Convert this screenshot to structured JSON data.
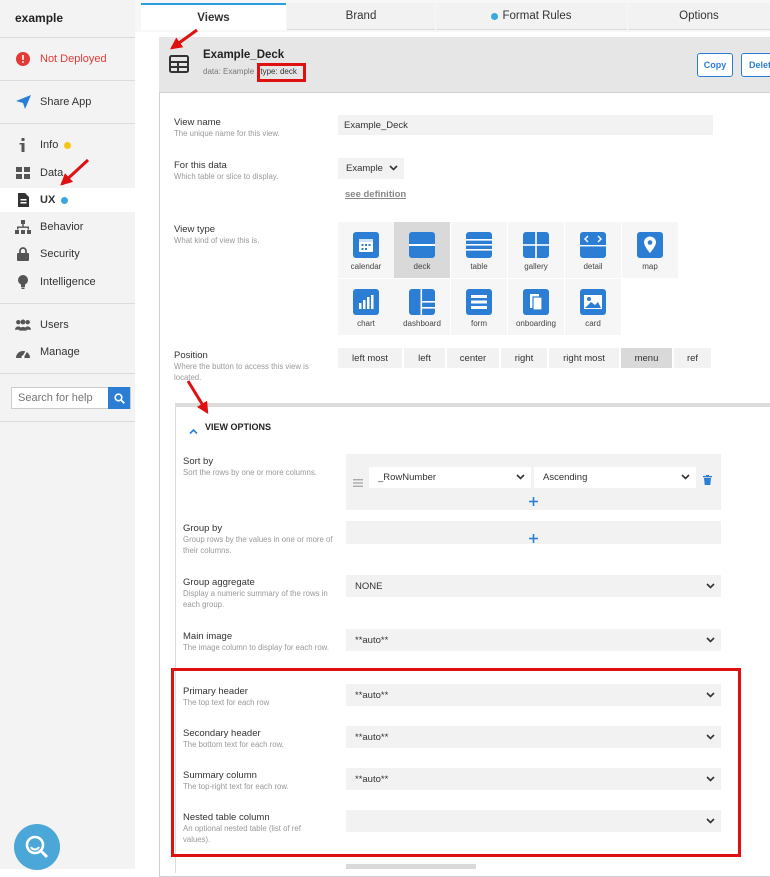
{
  "sidebar": {
    "app_name": "example",
    "deploy_status": "Not Deployed",
    "share": "Share App",
    "items": [
      {
        "label": "Info"
      },
      {
        "label": "Data"
      },
      {
        "label": "UX"
      },
      {
        "label": "Behavior"
      },
      {
        "label": "Security"
      },
      {
        "label": "Intelligence"
      },
      {
        "label": "Users"
      },
      {
        "label": "Manage"
      }
    ],
    "search_placeholder": "Search for help"
  },
  "tabs": [
    "Views",
    "Brand",
    "Format Rules",
    "Options"
  ],
  "view": {
    "title": "Example_Deck",
    "data_prefix": "data: Example",
    "type_text": "type: deck",
    "copy_label": "Copy",
    "delete_label": "Delete"
  },
  "form": {
    "view_name": {
      "label": "View name",
      "desc": "The unique name for this view.",
      "value": "Example_Deck"
    },
    "for_data": {
      "label": "For this data",
      "desc": "Which table or slice to display.",
      "value": "Example",
      "link": "see definition"
    },
    "view_type": {
      "label": "View type",
      "desc": "What kind of view this is.",
      "options": [
        "calendar",
        "deck",
        "table",
        "gallery",
        "detail",
        "map",
        "chart",
        "dashboard",
        "form",
        "onboarding",
        "card"
      ],
      "selected": "deck"
    },
    "position": {
      "label": "Position",
      "desc": "Where the button to access this view is located.",
      "options": [
        "left most",
        "left",
        "center",
        "right",
        "right most",
        "menu",
        "ref"
      ],
      "selected": "menu"
    }
  },
  "view_options": {
    "header": "VIEW OPTIONS",
    "sort_by": {
      "label": "Sort by",
      "desc": "Sort the rows by one or more columns.",
      "column": "_RowNumber",
      "order": "Ascending"
    },
    "group_by": {
      "label": "Group by",
      "desc": "Group rows by the values in one or more of their columns."
    },
    "group_aggregate": {
      "label": "Group aggregate",
      "desc": "Display a numeric summary of the rows in each group.",
      "value": "NONE"
    },
    "main_image": {
      "label": "Main image",
      "desc": "The image column to display for each row.",
      "value": "**auto**"
    },
    "primary_header": {
      "label": "Primary header",
      "desc": "The top text for each row",
      "value": "**auto**"
    },
    "secondary_header": {
      "label": "Secondary header",
      "desc": "The bottom text for each row.",
      "value": "**auto**"
    },
    "summary_column": {
      "label": "Summary column",
      "desc": "The top-right text for each row.",
      "value": "**auto**"
    },
    "nested_table": {
      "label": "Nested table column",
      "desc": "An optional nested table (list of ref values).",
      "value": ""
    }
  },
  "colors": {
    "accent": "#2b7ed3",
    "dot_yellow": "#f5c518",
    "dot_blue": "#3aa8e0",
    "highlight_red": "#e01010",
    "warning_red": "#e53935"
  }
}
